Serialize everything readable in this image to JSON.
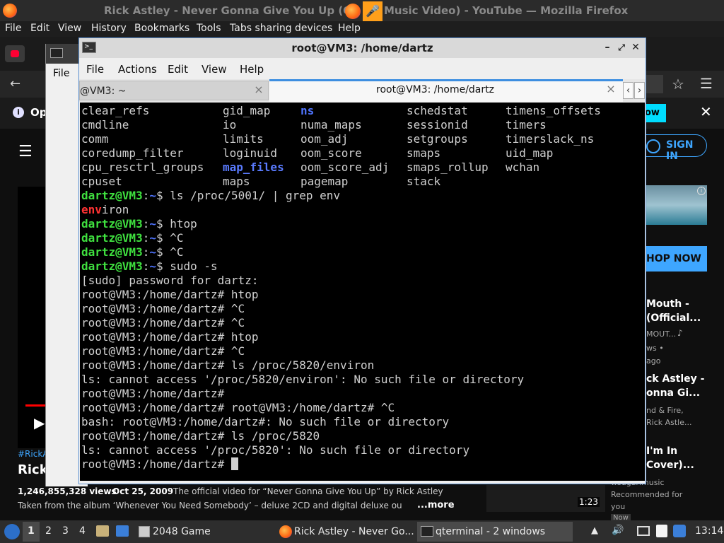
{
  "firefox": {
    "window_title": "Rick Astley - Never Gonna Give You Up (Official Music Video) - YouTube — Mozilla Firefox",
    "window_title_left": "Rick Astley - Never Gonna Give You Up (O",
    "window_title_right": "Music Video) - YouTube — Mozilla Firefox",
    "menu": [
      "File",
      "Edit",
      "View",
      "History",
      "Bookmarks",
      "Tools",
      "Tabs sharing devices",
      "Help"
    ]
  },
  "youtube": {
    "notif_prefix": "Op",
    "notif_button_tail": "ow",
    "sign_in": "SIGN IN",
    "shop_now": "HOP NOW",
    "hashtag": "#RickA",
    "title_fragment": "Rick",
    "views": "1,246,855,328 views",
    "date": "Oct 25, 2009",
    "desc_line1": "The official video for “Never Gonna Give You Up” by Rick Astley",
    "desc_line2": "Taken from the album ‘Whenever You Need Somebody’ – deluxe 2CD and digital deluxe ou",
    "more": "...more",
    "duration": "1:23",
    "recommended": [
      {
        "title": [
          "Mouth -",
          "(Official..."
        ],
        "meta": [
          "MOUT...",
          "ws •",
          "ago"
        ]
      },
      {
        "title": [
          "ck Astley -",
          "onna Gi..."
        ],
        "meta": [
          "nd & Fire,",
          "Rick Astle..."
        ]
      },
      {
        "title": [
          "I'm In",
          "Cover)..."
        ],
        "meta": [
          "wsugarimusic",
          "Recommended for",
          "you"
        ]
      }
    ],
    "new_badge": "Now"
  },
  "qterminal_bg": {
    "file_menu": "File"
  },
  "terminal": {
    "title": "root@VM3: /home/dartz",
    "menu": [
      "File",
      "Actions",
      "Edit",
      "View",
      "Help"
    ],
    "tabs": [
      {
        "label": "@VM3: ~"
      },
      {
        "label": "root@VM3: /home/dartz"
      }
    ],
    "ls_rows": [
      [
        "clear_refs",
        "gid_map",
        "ns",
        "schedstat",
        "timens_offsets"
      ],
      [
        "cmdline",
        "io",
        "numa_maps",
        "sessionid",
        "timers"
      ],
      [
        "comm",
        "limits",
        "oom_adj",
        "setgroups",
        "timerslack_ns"
      ],
      [
        "coredump_filter",
        "loginuid",
        "oom_score",
        "smaps",
        "uid_map"
      ],
      [
        "cpu_resctrl_groups",
        "map_files",
        "oom_score_adj",
        "smaps_rollup",
        "wchan"
      ],
      [
        "cpuset",
        "maps",
        "pagemap",
        "stack",
        ""
      ]
    ],
    "user_prompt": "dartz@VM3",
    "user_prompt_sep": ":",
    "user_prompt_path": "~",
    "user_prompt_end": "$ ",
    "cmd_grep": "ls /proc/5001/ | grep env",
    "grep_match": "env",
    "grep_rest": "iron",
    "user_cmds": [
      "htop",
      "^C",
      "^C",
      "sudo -s"
    ],
    "root_lines": [
      "[sudo] password for dartz:",
      "root@VM3:/home/dartz# htop",
      "root@VM3:/home/dartz# ^C",
      "root@VM3:/home/dartz# ^C",
      "root@VM3:/home/dartz# htop",
      "root@VM3:/home/dartz# ^C",
      "root@VM3:/home/dartz# ls /proc/5820/environ",
      "ls: cannot access '/proc/5820/environ': No such file or directory",
      "root@VM3:/home/dartz#",
      "root@VM3:/home/dartz# root@VM3:/home/dartz# ^C",
      "bash: root@VM3:/home/dartz#: No such file or directory",
      "root@VM3:/home/dartz# ls /proc/5820",
      "ls: cannot access '/proc/5820': No such file or directory"
    ],
    "last_prompt": "root@VM3:/home/dartz# "
  },
  "taskbar": {
    "workspaces": [
      "1",
      "2",
      "3",
      "4"
    ],
    "tasks": [
      "2048 Game",
      "Rick Astley - Never Go...",
      "qterminal - 2 windows"
    ],
    "clock": "13:14"
  }
}
